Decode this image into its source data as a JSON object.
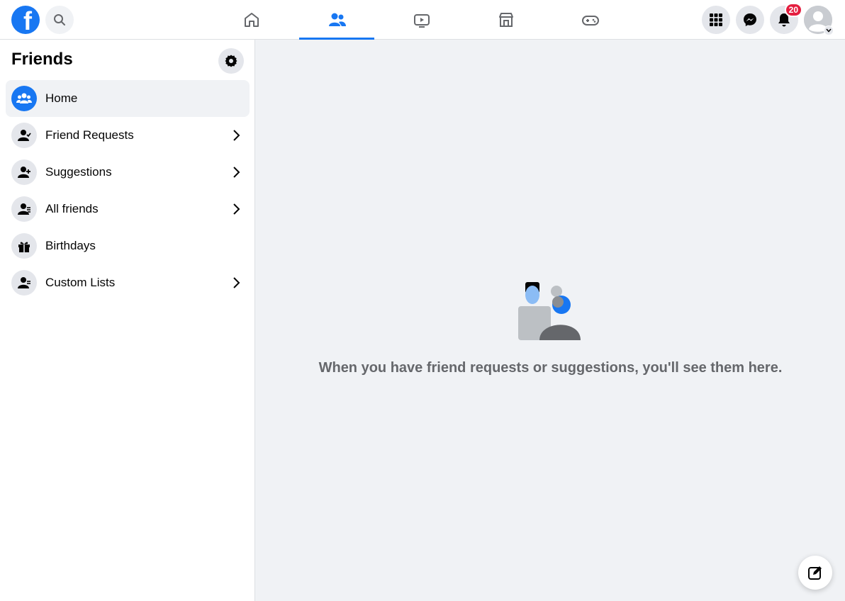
{
  "header": {
    "logo_letter": "f",
    "nav_tabs": [
      {
        "name": "home",
        "active": false
      },
      {
        "name": "friends",
        "active": true
      },
      {
        "name": "watch",
        "active": false
      },
      {
        "name": "marketplace",
        "active": false
      },
      {
        "name": "gaming",
        "active": false
      }
    ],
    "right_buttons": [
      "menu-grid-icon",
      "messenger-icon",
      "bell-icon",
      "account-avatar"
    ],
    "notifications_count": "20",
    "accent_color": "#1877f2"
  },
  "sidebar": {
    "title": "Friends",
    "items": [
      {
        "label": "Home",
        "icon": "friends-home-icon",
        "has_chevron": false,
        "active": true
      },
      {
        "label": "Friend Requests",
        "icon": "friend-requests-icon",
        "has_chevron": true,
        "active": false
      },
      {
        "label": "Suggestions",
        "icon": "suggestions-icon",
        "has_chevron": true,
        "active": false
      },
      {
        "label": "All friends",
        "icon": "all-friends-icon",
        "has_chevron": true,
        "active": false
      },
      {
        "label": "Birthdays",
        "icon": "gift-icon",
        "has_chevron": false,
        "active": false
      },
      {
        "label": "Custom Lists",
        "icon": "custom-lists-icon",
        "has_chevron": true,
        "active": false
      }
    ]
  },
  "main": {
    "empty_message": "When you have friend requests or suggestions, you'll see them here."
  }
}
